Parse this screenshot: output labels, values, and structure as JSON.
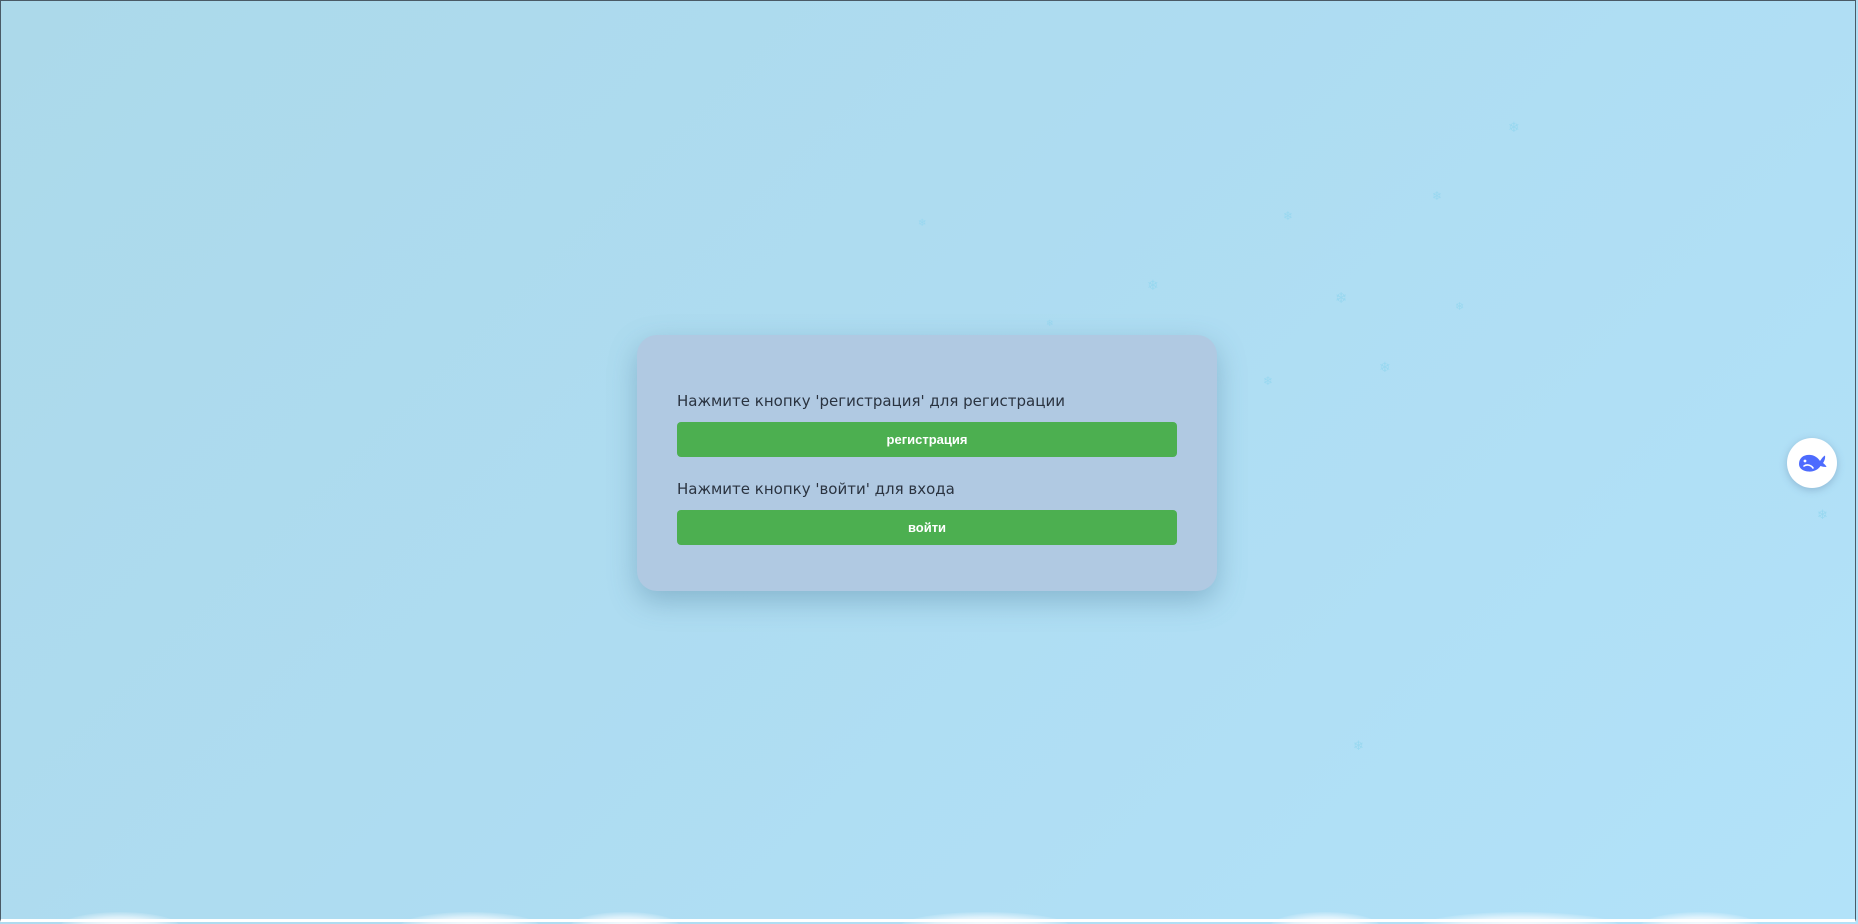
{
  "card": {
    "register_prompt": "Нажмите кнопку 'регистрация' для регистрации",
    "register_button": "регистрация",
    "login_prompt": "Нажмите кнопку 'войти' для входа",
    "login_button": "войти"
  },
  "assistant_button": {
    "icon": "whale-icon"
  },
  "colors": {
    "button_green": "#4caf50",
    "card_background": "#b0c9e2",
    "assistant_icon": "#4d6bfe"
  }
}
